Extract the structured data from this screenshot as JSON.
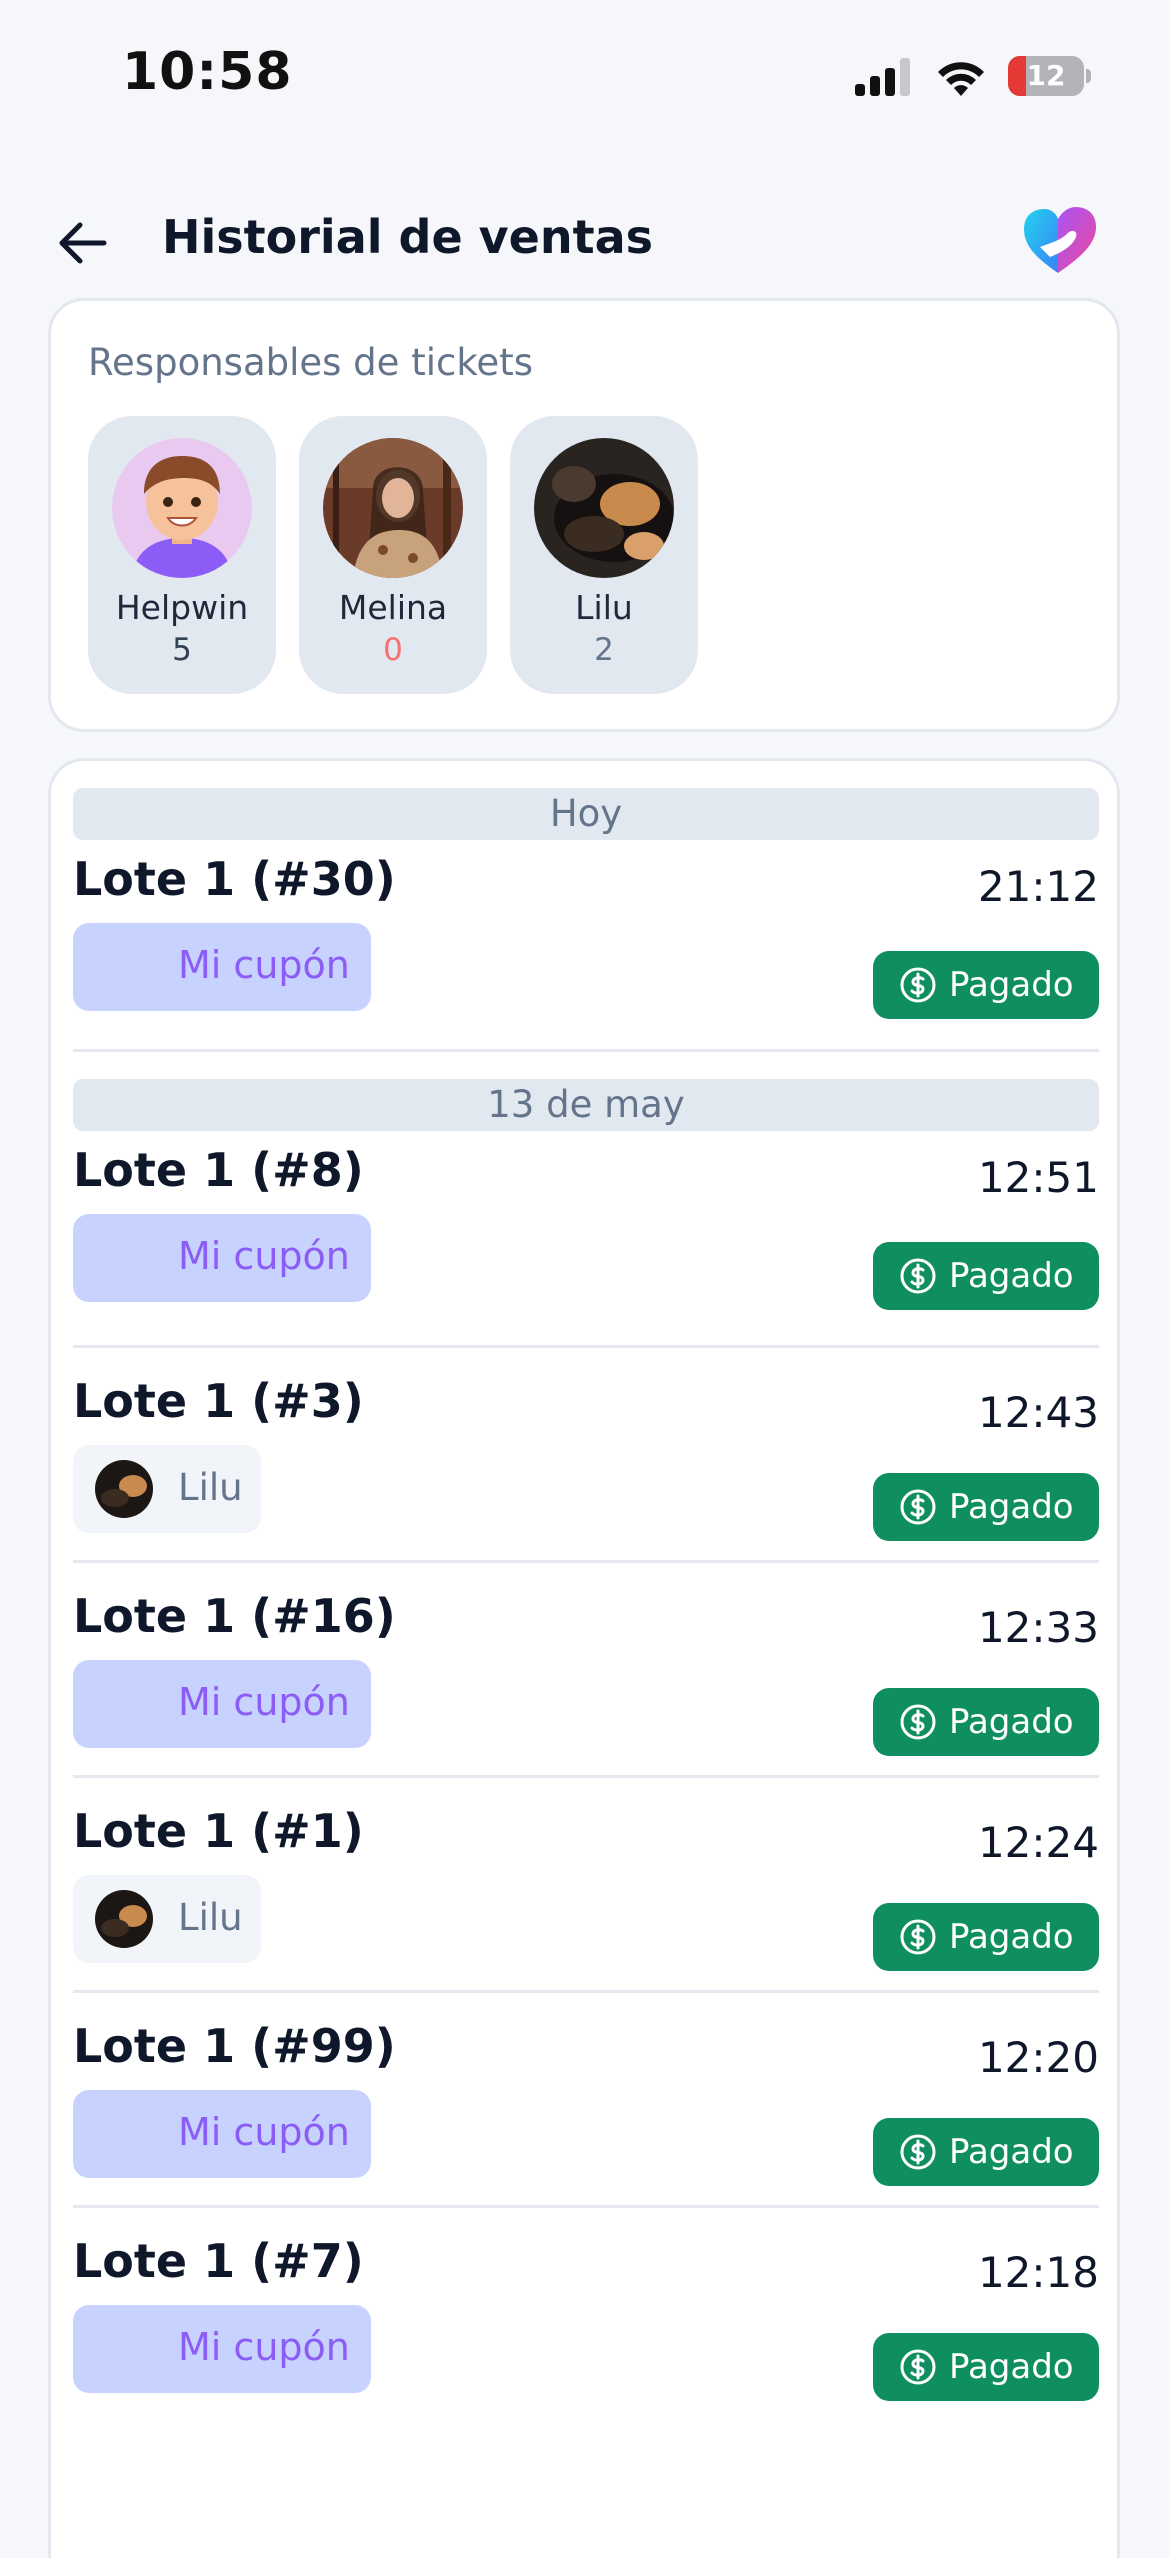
{
  "status_bar": {
    "time": "10:58",
    "battery_percent": "12"
  },
  "header": {
    "title": "Historial de ventas",
    "back_icon": "arrow-left-icon",
    "logo_icon": "heart-hand-logo"
  },
  "responsables": {
    "title": "Responsables de tickets",
    "people": [
      {
        "name": "Helpwin",
        "count": "5"
      },
      {
        "name": "Melina",
        "count": "0"
      },
      {
        "name": "Lilu",
        "count": "2"
      }
    ]
  },
  "sales": {
    "groups": [
      {
        "date_label": "Hoy"
      },
      {
        "date_label": "13 de may"
      }
    ],
    "status_label": "Pagado",
    "coupon_label": "Mi cupón",
    "rows": [
      {
        "title": "Lote 1 (#30)",
        "time": "21:12",
        "chip": "Mi cupón"
      },
      {
        "title": "Lote 1 (#8)",
        "time": "12:51",
        "chip": "Mi cupón"
      },
      {
        "title": "Lote 1 (#3)",
        "time": "12:43",
        "chip": "Lilu"
      },
      {
        "title": "Lote 1 (#16)",
        "time": "12:33",
        "chip": "Mi cupón"
      },
      {
        "title": "Lote 1 (#1)",
        "time": "12:24",
        "chip": "Lilu"
      },
      {
        "title": "Lote 1 (#99)",
        "time": "12:20",
        "chip": "Mi cupón"
      },
      {
        "title": "Lote 1 (#7)",
        "time": "12:18",
        "chip": "Mi cupón"
      }
    ]
  },
  "colors": {
    "paid_green": "#0f8f5f",
    "coupon_bg": "#c7d2fe",
    "coupon_text": "#8b5cf6",
    "zero_count": "#f87171"
  }
}
